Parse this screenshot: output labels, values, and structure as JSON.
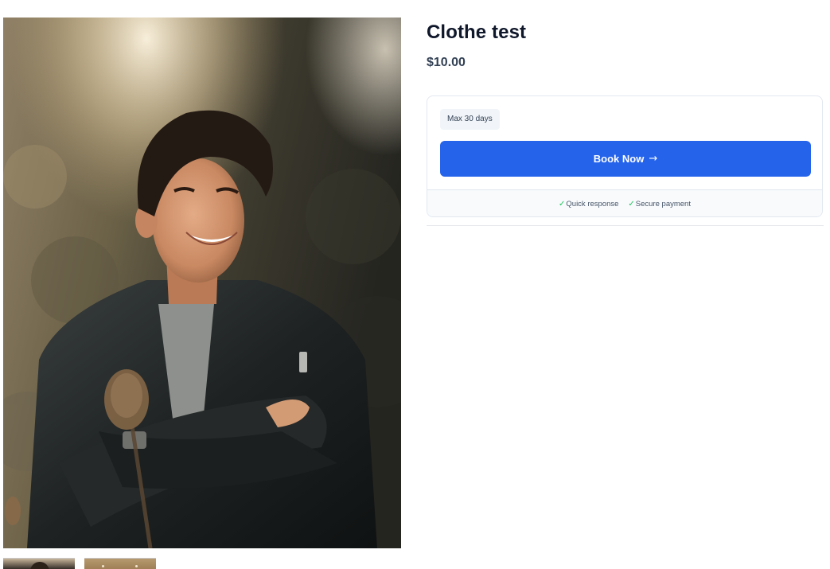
{
  "product": {
    "title": "Clothe test",
    "price": "$10.00",
    "image_alt": "Smiling young man with crossed arms in a dark jacket outdoors"
  },
  "booking": {
    "duration_badge": "Max 30 days",
    "book_label": "Book Now",
    "book_icon": "arrow-right-icon"
  },
  "features": [
    {
      "icon": "check-icon",
      "label": "Quick response"
    },
    {
      "icon": "check-icon",
      "label": "Secure payment"
    }
  ],
  "thumbnails": [
    {
      "selected": true
    },
    {
      "selected": false
    }
  ],
  "colors": {
    "accent": "#2563eb",
    "check": "#22c55e",
    "title": "#0f172a",
    "price": "#334155"
  }
}
